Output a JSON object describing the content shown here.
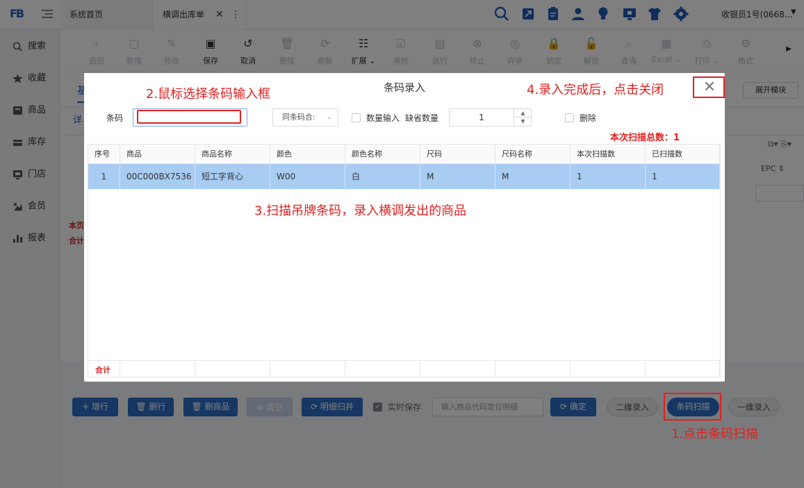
{
  "topbar": {
    "logo": "FB",
    "tabs": [
      {
        "label": "系统首页"
      },
      {
        "label": "横调出库单",
        "close": "✕",
        "more": "⋮"
      }
    ],
    "user": "收银员1号(0668...",
    "user_caret": "▼"
  },
  "sidebar": {
    "items": [
      {
        "label": "搜索",
        "icon": "search-icon"
      },
      {
        "label": "收藏",
        "icon": "star-icon"
      },
      {
        "label": "商品",
        "icon": "product-icon"
      },
      {
        "label": "库存",
        "icon": "inventory-icon"
      },
      {
        "label": "门店",
        "icon": "store-icon"
      },
      {
        "label": "会员",
        "icon": "member-icon"
      },
      {
        "label": "报表",
        "icon": "report-icon"
      }
    ]
  },
  "toolbar": {
    "buttons": [
      {
        "label": "返回",
        "icon": "‹",
        "enabled": false
      },
      {
        "label": "新增",
        "icon": "▢",
        "enabled": false
      },
      {
        "label": "修改",
        "icon": "✎",
        "enabled": false
      },
      {
        "label": "保存",
        "icon": "▣",
        "enabled": true
      },
      {
        "label": "取消",
        "icon": "↺",
        "enabled": true
      },
      {
        "label": "删除",
        "icon": "🗑",
        "enabled": false
      },
      {
        "label": "刷新",
        "icon": "⟳",
        "enabled": false
      },
      {
        "label": "扩展 ⌄",
        "icon": "☷",
        "enabled": true
      },
      {
        "label": "审核",
        "icon": "☑",
        "enabled": false
      },
      {
        "label": "执行",
        "icon": "▤",
        "enabled": false
      },
      {
        "label": "终止",
        "icon": "⊗",
        "enabled": false
      },
      {
        "label": "弃审",
        "icon": "◎",
        "enabled": false
      },
      {
        "label": "锁定",
        "icon": "🔒",
        "enabled": false
      },
      {
        "label": "解锁",
        "icon": "🔓",
        "enabled": false
      },
      {
        "label": "查询",
        "icon": "⌕",
        "enabled": false
      },
      {
        "label": "Excel ⌄",
        "icon": "▦",
        "enabled": false
      },
      {
        "label": "打印 ⌄",
        "icon": "⎙",
        "enabled": false
      },
      {
        "label": "格式",
        "icon": "⚙",
        "enabled": false
      }
    ]
  },
  "background": {
    "expand_module": "展开模块",
    "detail_tab": "详",
    "page_tab": "基",
    "epc": "EPC ⇕",
    "page_label": "本页",
    "total_label": "合计"
  },
  "action_bar": {
    "add_row": "+ 增行",
    "delete_row": "🗑 删行",
    "delete_product": "🗑 删商品",
    "clear": "⊗ 清空",
    "merge_detail": "⟳ 明细归并",
    "realtime_save": "实时保存",
    "locate_placeholder": "输入商品代码定位明细",
    "confirm": "⟳ 确定",
    "qr_entry": "二维录入",
    "barcode_scan": "条码扫描",
    "one_dim_entry": "一维录入"
  },
  "modal": {
    "title": "条码录入",
    "close": "✕",
    "barcode_label": "条码",
    "barcode_value": "",
    "mode_select": "同条码合:",
    "mode_caret": "⌄",
    "qty_input_label": "数量输入",
    "default_qty_label": "缺省数量",
    "default_qty_value": "1",
    "delete_label": "删除",
    "scan_total": "本次扫描总数：1",
    "columns": [
      "序号",
      "商品",
      "商品名称",
      "颜色",
      "颜色名称",
      "尺码",
      "尺码名称",
      "本次扫描数",
      "已扫描数"
    ],
    "rows": [
      [
        "1",
        "00C000BX7536",
        "短工字背心",
        "W00",
        "白",
        "M",
        "M",
        "1",
        "1"
      ]
    ],
    "footer_total": "合计"
  },
  "annotations": {
    "step1": "1.点击条码扫描",
    "step2": "2.鼠标选择条码输入框",
    "step3": "3.扫描吊牌条码，录入横调发出的商品",
    "step4": "4.录入完成后，点击关闭"
  },
  "colors": {
    "primary": "#2c6cc7",
    "annotation_red": "#e02020",
    "selected_row": "#a8ccf2"
  }
}
